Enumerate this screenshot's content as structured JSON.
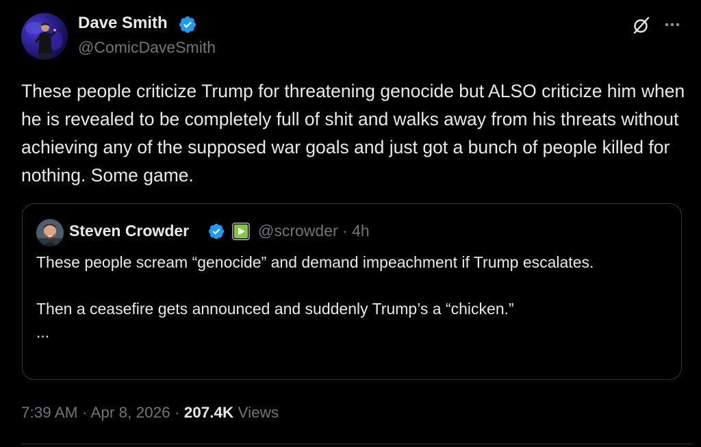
{
  "author": {
    "display_name": "Dave Smith",
    "handle": "@ComicDaveSmith",
    "verified": true
  },
  "tweet": {
    "text": "These people criticize Trump for threatening genocide but ALSO criticize him when he is revealed to be completely full of shit and walks away from his threats without achieving any of the supposed war goals and just got a bunch of people killed for nothing. Some game."
  },
  "quoted_tweet": {
    "display_name": "Steven Crowder",
    "handle": "@scrowder",
    "separator": "·",
    "time_ago": "4h",
    "handle_line": "@scrowder · 4h",
    "paragraphs": [
      "These people scream “genocide” and demand impeachment if Trump escalates.",
      "Then a ceasefire gets announced and suddenly Trump’s a “chicken.”",
      "..."
    ]
  },
  "meta": {
    "time": "7:39 AM",
    "separator": "·",
    "date": "Apr 8, 2026",
    "views_count": "207.4K",
    "views_label": "Views"
  },
  "icons": {
    "verified": "verified-badge-icon",
    "grok": "grok-icon",
    "more": "more-options-icon",
    "affiliate": "rumble-play-icon"
  },
  "colors": {
    "background": "#000000",
    "text_primary": "#e7e9ea",
    "text_secondary": "#71767b",
    "verified_blue": "#1d9bf0",
    "border": "#333639",
    "rumble_green": "#85c742"
  }
}
